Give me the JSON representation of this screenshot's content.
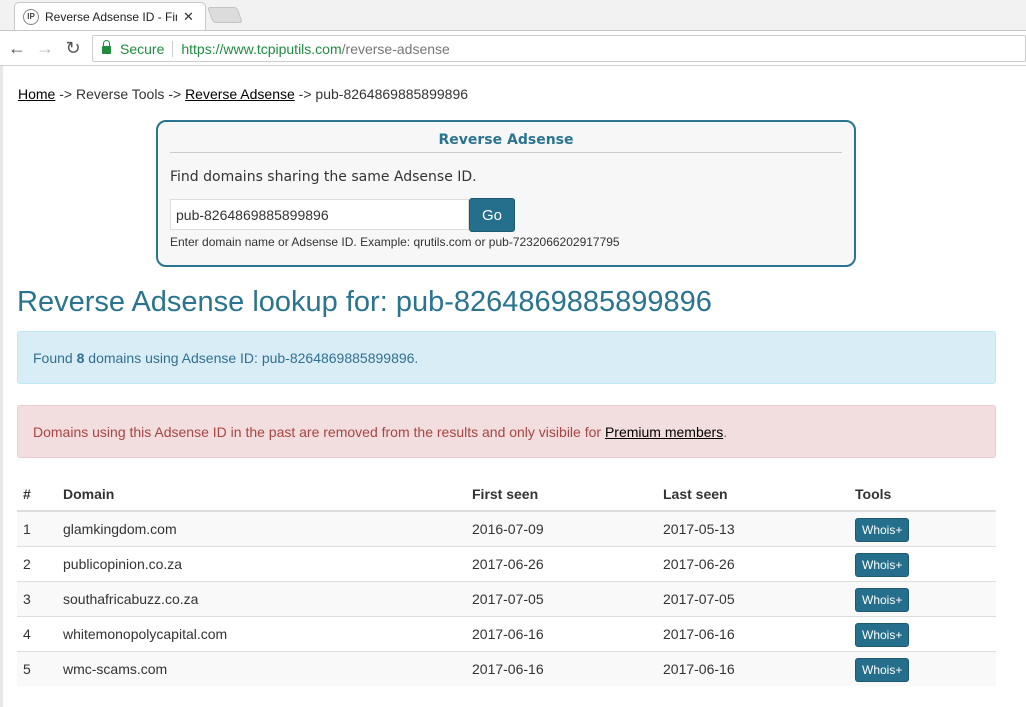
{
  "browser": {
    "tab_title": "Reverse Adsense ID - Find",
    "favicon_text": "IP",
    "secure_label": "Secure",
    "url_main": "https://www.tcpiputils.com",
    "url_path": "/reverse-adsense"
  },
  "breadcrumb": {
    "home": "Home",
    "sep1": " -> ",
    "reverse_tools": "Reverse Tools",
    "sep2": " -> ",
    "reverse_adsense": "Reverse Adsense",
    "sep3": " -> ",
    "current": "pub-8264869885899896"
  },
  "lookup": {
    "title": "Reverse Adsense",
    "description": "Find domains sharing the same Adsense ID.",
    "input_value": "pub-8264869885899896",
    "button_label": "Go",
    "hint": "Enter domain name or Adsense ID. Example: qrutils.com or pub-7232066202917795"
  },
  "page_title": "Reverse Adsense lookup for: pub-8264869885899896",
  "info": {
    "prefix": "Found ",
    "count": "8",
    "suffix": " domains using Adsense ID: pub-8264869885899896."
  },
  "warning": {
    "text": "Domains using this Adsense ID in the past are removed from the results and only visibile for ",
    "link": "Premium members",
    "end": "."
  },
  "table": {
    "headers": [
      "#",
      "Domain",
      "First seen",
      "Last seen",
      "Tools"
    ],
    "rows": [
      {
        "n": "1",
        "domain": "glamkingdom.com",
        "first": "2016-07-09",
        "last": "2017-05-13",
        "tool": "Whois+"
      },
      {
        "n": "2",
        "domain": "publicopinion.co.za",
        "first": "2017-06-26",
        "last": "2017-06-26",
        "tool": "Whois+"
      },
      {
        "n": "3",
        "domain": "southafricabuzz.co.za",
        "first": "2017-07-05",
        "last": "2017-07-05",
        "tool": "Whois+"
      },
      {
        "n": "4",
        "domain": "whitemonopolycapital.com",
        "first": "2017-06-16",
        "last": "2017-06-16",
        "tool": "Whois+"
      },
      {
        "n": "5",
        "domain": "wmc-scams.com",
        "first": "2017-06-16",
        "last": "2017-06-16",
        "tool": "Whois+"
      }
    ]
  },
  "icons": {
    "back": "←",
    "forward": "→",
    "reload": "↻",
    "close": "✕"
  },
  "colors": {
    "accent": "#2a7490",
    "button": "#256f8c",
    "info_bg": "#d9edf7",
    "danger_bg": "#f2dede",
    "secure_green": "#1e8e3e"
  }
}
